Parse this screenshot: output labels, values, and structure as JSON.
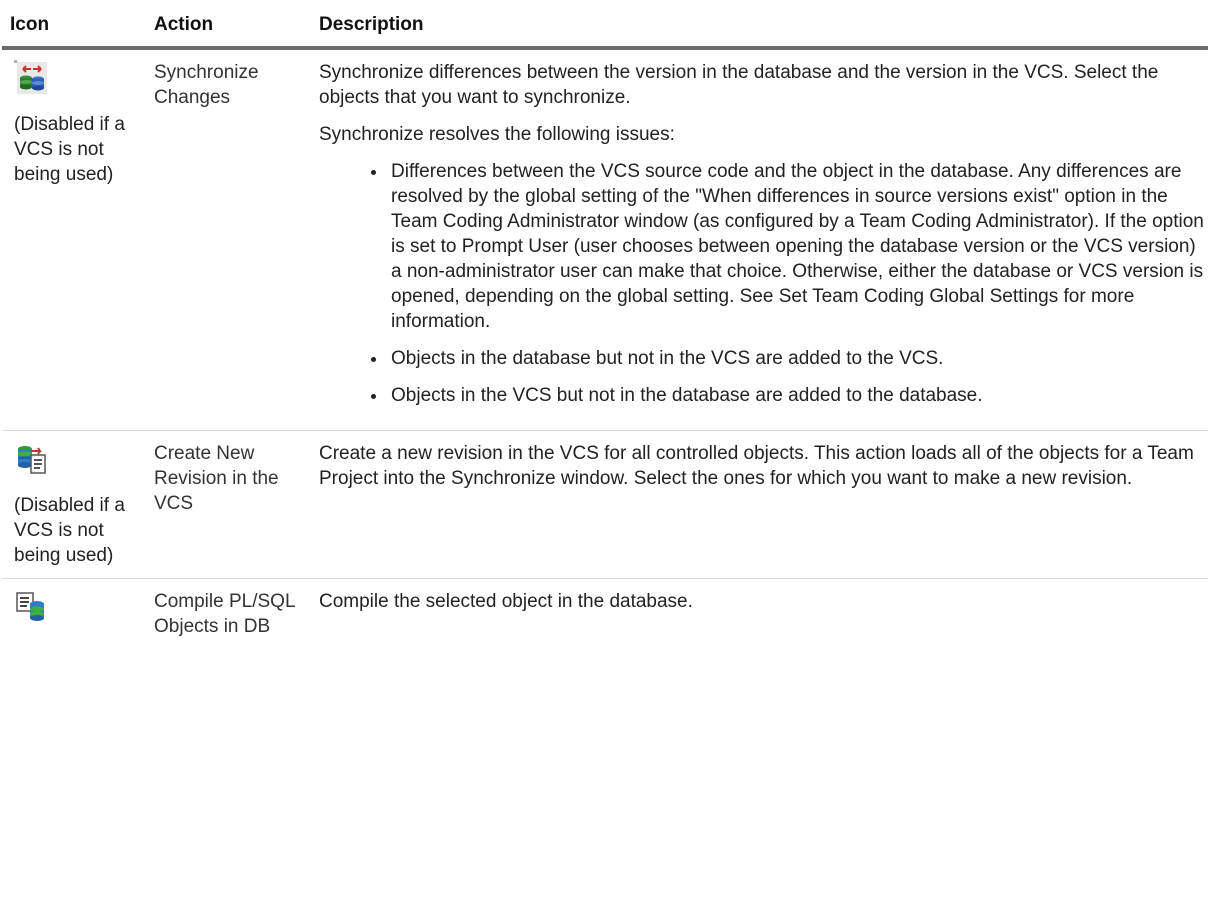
{
  "header": {
    "icon": "Icon",
    "action": "Action",
    "description": "Description"
  },
  "rows": [
    {
      "icon_name": "synchronize-changes-icon",
      "note": "(Disabled if a VCS is not being used)",
      "action": "Synchronize Changes",
      "paragraphs": [
        "Synchronize differences between the version in the database and the version in the VCS. Select the objects that you want to synchronize.",
        "Synchronize resolves the following issues:"
      ],
      "bullets": [
        "Differences between the VCS source code and the object in the database. Any differences are resolved by the global setting of the \"When differences in source versions exist\" option in the Team Coding Administrator window (as configured by a Team Coding Administrator). If the option is set to Prompt User (user chooses between opening the database version or the VCS version) a non-administrator user can make that choice. Otherwise, either the database or VCS version is opened, depending on the global setting. See Set Team Coding Global Settings for more information.",
        "Objects in the database but not in the VCS are added to the VCS.",
        "Objects in the VCS but not in the database are added to the database."
      ]
    },
    {
      "icon_name": "create-new-revision-icon",
      "note": "(Disabled if a VCS is not being used)",
      "action": "Create New Revision in the VCS",
      "paragraphs": [
        "Create a new revision in the VCS for all controlled objects. This action loads all of the objects for a Team Project into the Synchronize window. Select the ones for which you want to make a new revision."
      ]
    },
    {
      "icon_name": "compile-plsql-icon",
      "action": "Compile PL/SQL Objects in DB",
      "paragraphs": [
        "Compile the selected object in the database."
      ]
    }
  ]
}
